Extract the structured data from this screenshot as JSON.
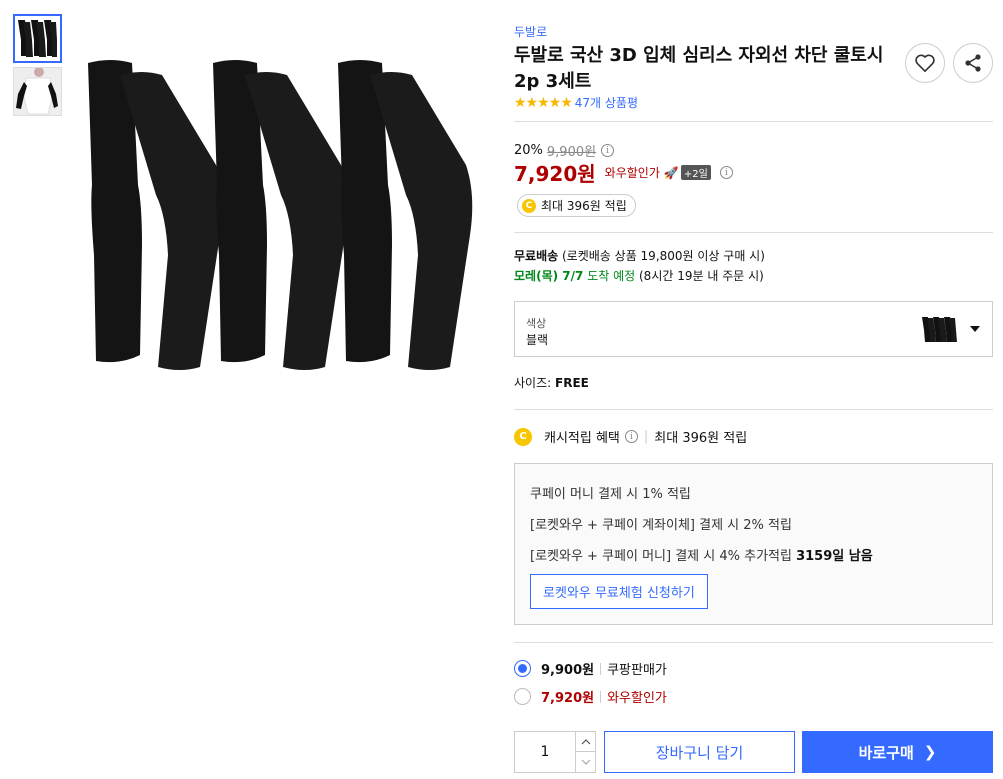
{
  "product": {
    "brand": "두발로",
    "title": "두발로 국산 3D 입체 심리스 자외선 차단 쿨토시 2p 3세트",
    "rating_stars": "★★★★★",
    "rating_value": 4.5,
    "review_count": "47개 상품평"
  },
  "price": {
    "discount_rate": "20%",
    "original_price": "9,900원",
    "sale_price": "7,920원",
    "sale_label": "와우할인가",
    "plus_badge": "+2일",
    "cash_pill": "최대 396원 적립"
  },
  "shipping": {
    "free_label": "무료배송",
    "free_condition": "(로켓배송 상품 19,800원 이상 구매 시)",
    "arrival_day": "모레(목) 7/7",
    "arrival_text": "도착 예정",
    "arrival_condition": "(8시간 19분 내 주문 시)"
  },
  "option": {
    "label": "색상",
    "value": "블랙"
  },
  "size": {
    "label": "사이즈:",
    "value": "FREE"
  },
  "cash": {
    "coin": "C",
    "title": "캐시적립 혜택",
    "max": "최대 396원 적립",
    "lines": [
      "쿠페이 머니 결제 시 1% 적립",
      "[로켓와우 + 쿠페이 계좌이체] 결제 시 2% 적립",
      "[로켓와우 + 쿠페이 머니] 결제 시 4% 추가적립"
    ],
    "days_left": "3159일 남음",
    "trial_button": "로켓와우 무료체험 신청하기"
  },
  "price_options": [
    {
      "price": "9,900원",
      "label": "쿠팡판매가",
      "selected": true
    },
    {
      "price": "7,920원",
      "label": "와우할인가",
      "selected": false
    }
  ],
  "purchase": {
    "quantity": "1",
    "cart_button": "장바구니 담기",
    "buy_button": "바로구매"
  },
  "colors": {
    "accent": "#346aff",
    "sale": "#ae0000",
    "arrival": "#00891a",
    "star": "#f7b600"
  }
}
